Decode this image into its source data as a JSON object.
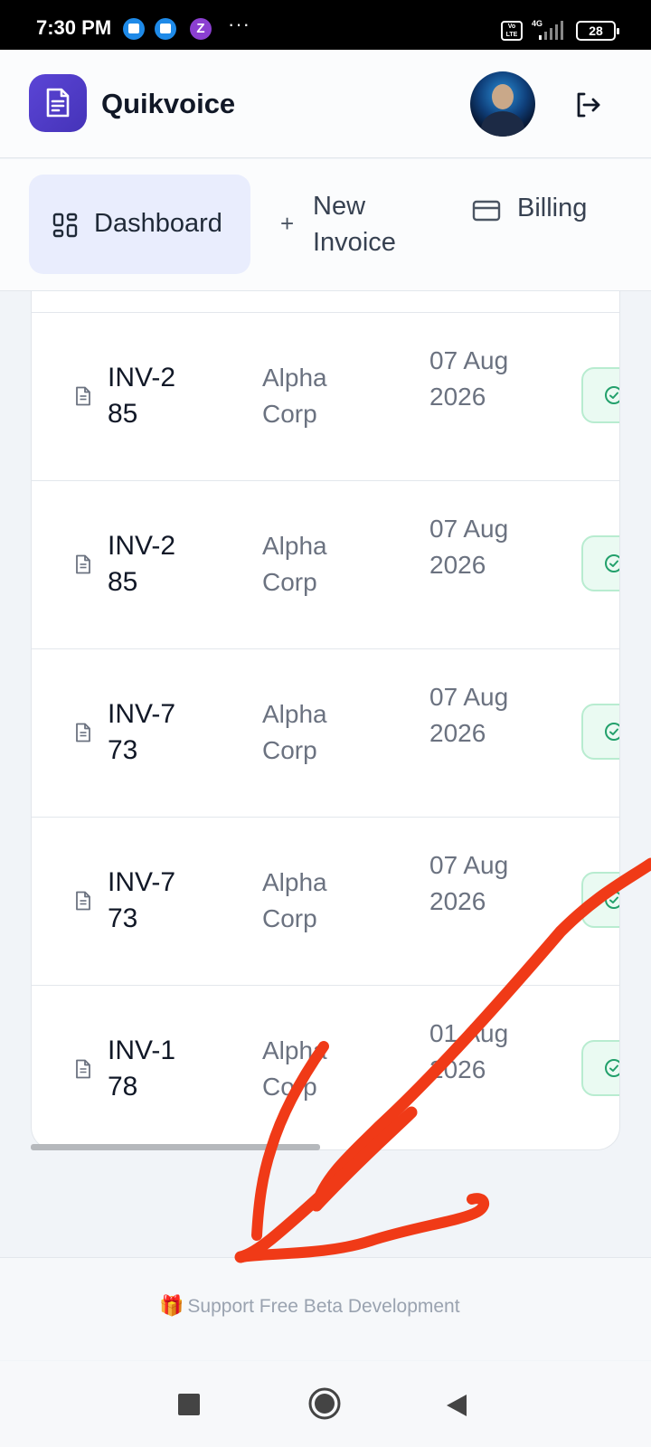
{
  "status_bar": {
    "time": "7:30 PM",
    "dots": "···",
    "z_icon": "Z",
    "volte": "Vo LTE",
    "network": "4G",
    "battery": "28"
  },
  "header": {
    "app_name": "Quikvoice",
    "logo_icon": "document-icon",
    "logout_icon": "logout-icon"
  },
  "nav": {
    "dashboard": "Dashboard",
    "new_invoice_plus": "+",
    "new_invoice": "New Invoice",
    "billing": "Billing"
  },
  "invoices": [
    {
      "id": "INV-285",
      "client": "Alpha Corp",
      "date": "07 Aug 2026",
      "status_icon": "check-circle-icon"
    },
    {
      "id": "INV-285",
      "client": "Alpha Corp",
      "date": "07 Aug 2026",
      "status_icon": "check-circle-icon"
    },
    {
      "id": "INV-773",
      "client": "Alpha Corp",
      "date": "07 Aug 2026",
      "status_icon": "check-circle-icon"
    },
    {
      "id": "INV-773",
      "client": "Alpha Corp",
      "date": "07 Aug 2026",
      "status_icon": "check-circle-icon"
    },
    {
      "id": "INV-178",
      "client": "Alpha Corp",
      "date": "01 Aug 2026",
      "status_icon": "check-circle-icon"
    }
  ],
  "footer": {
    "gift_icon": "🎁",
    "support_link": "Support Free Beta Development"
  },
  "colors": {
    "brand": "#5b45d6",
    "nav_active_bg": "#e9edfd",
    "status_paid": "#22a06b",
    "annotation": "#f03a17"
  }
}
